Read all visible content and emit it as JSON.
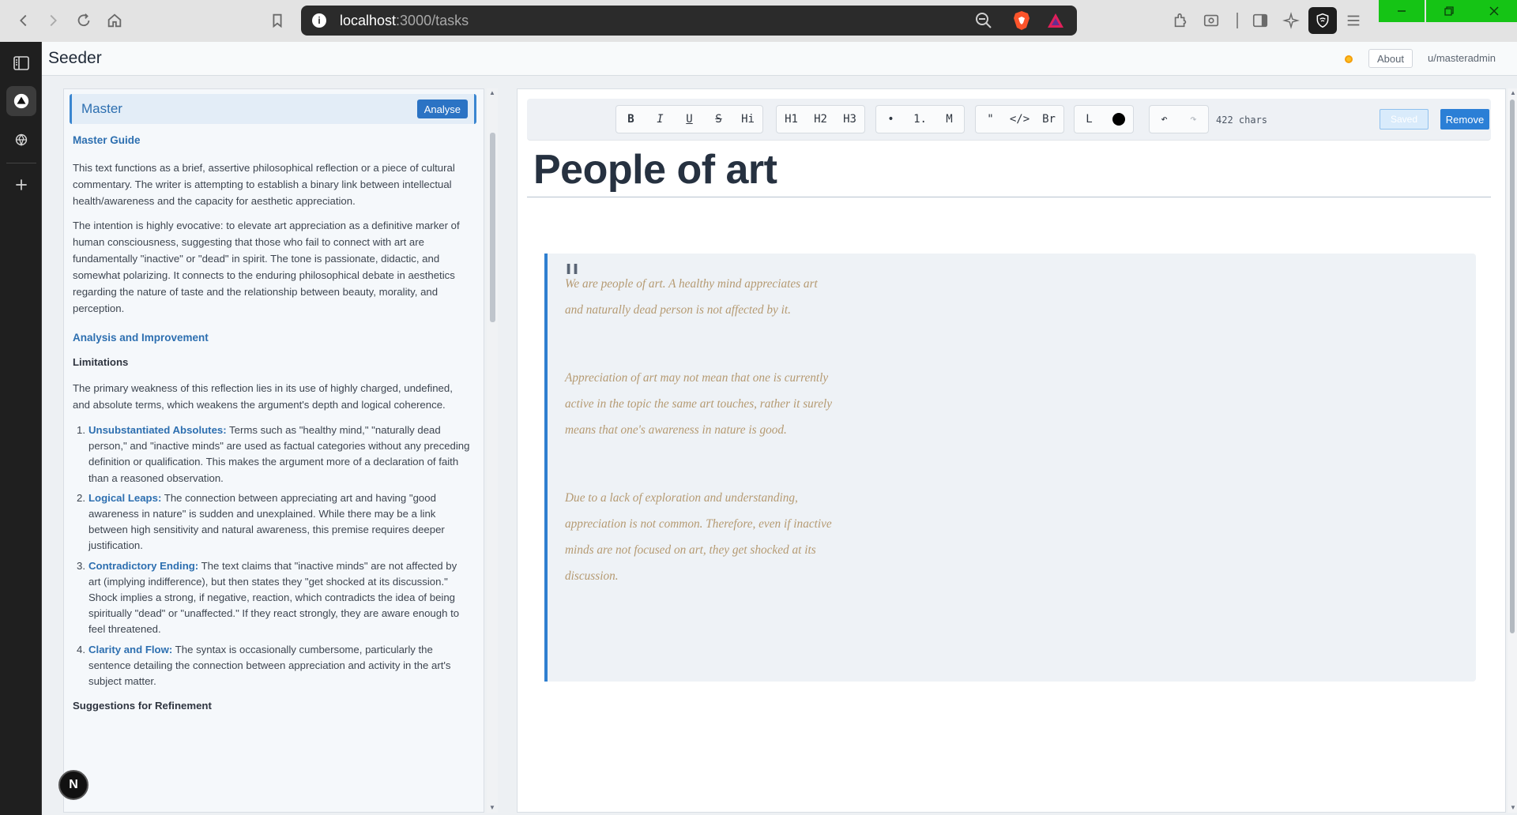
{
  "browser": {
    "url_host": "localhost",
    "url_path": ":3000/tasks"
  },
  "app": {
    "title": "Seeder",
    "about_label": "About",
    "user": "u/masteradmin",
    "badge": "N"
  },
  "guide": {
    "header_title": "Master",
    "analyse_label": "Analyse",
    "section1_title": "Master Guide",
    "section1_p1": "This text functions as a brief, assertive philosophical reflection or a piece of cultural commentary. The writer is attempting to establish a binary link between intellectual health/awareness and the capacity for aesthetic appreciation.",
    "section1_p2": "The intention is highly evocative: to elevate art appreciation as a definitive marker of human consciousness, suggesting that those who fail to connect with art are fundamentally \"inactive\" or \"dead\" in spirit. The tone is passionate, didactic, and somewhat polarizing. It connects to the enduring philosophical debate in aesthetics regarding the nature of taste and the relationship between beauty, morality, and perception.",
    "section2_title": "Analysis and Improvement",
    "limitations_title": "Limitations",
    "limitations_p": "The primary weakness of this reflection lies in its use of highly charged, undefined, and absolute terms, which weakens the argument's depth and logical coherence.",
    "items": [
      {
        "num": "1.",
        "term": "Unsubstantiated Absolutes:",
        "text": " Terms such as \"healthy mind,\" \"naturally dead person,\" and \"inactive minds\" are used as factual categories without any preceding definition or qualification. This makes the argument more of a declaration of faith than a reasoned observation."
      },
      {
        "num": "2.",
        "term": "Logical Leaps:",
        "text": " The connection between appreciating art and having \"good awareness in nature\" is sudden and unexplained. While there may be a link between high sensitivity and natural awareness, this premise requires deeper justification."
      },
      {
        "num": "3.",
        "term": "Contradictory Ending:",
        "text": " The text claims that \"inactive minds\" are not affected by art (implying indifference), but then states they \"get shocked at its discussion.\" Shock implies a strong, if negative, reaction, which contradicts the idea of being spiritually \"dead\" or \"unaffected.\" If they react strongly, they are aware enough to feel threatened."
      },
      {
        "num": "4.",
        "term": "Clarity and Flow:",
        "text": " The syntax is occasionally cumbersome, particularly the sentence detailing the connection between appreciation and activity in the art's subject matter."
      }
    ],
    "suggestions_title": "Suggestions for Refinement"
  },
  "toolbar": {
    "bold": "B",
    "italic": "I",
    "underline": "U",
    "strike": "S",
    "highlight": "Hi",
    "h1": "H1",
    "h2": "H2",
    "h3": "H3",
    "bullet": "•",
    "ordered": "1.",
    "m": "M",
    "quote": "\"",
    "code": "</>",
    "br": "Br",
    "link": "L",
    "undo": "↶",
    "redo": "↷",
    "char_count": "422 chars",
    "saved_label": "Saved",
    "remove_label": "Remove"
  },
  "document": {
    "title": "People of art",
    "quote_mark": "\"",
    "paragraphs": [
      "We are people of art. A healthy mind appreciates art and naturally dead person is not affected by it.",
      "Appreciation of art may not mean that one is currently active in the topic the same art touches, rather it surely means that one's awareness in nature is good.",
      "Due to a lack of exploration and understanding, appreciation is not common. Therefore, even if inactive minds are not focused on art, they get shocked at its discussion."
    ]
  },
  "colors": {
    "accent": "#2b73c4",
    "quote_text": "#b59a72",
    "window_controls": "#15c415"
  }
}
